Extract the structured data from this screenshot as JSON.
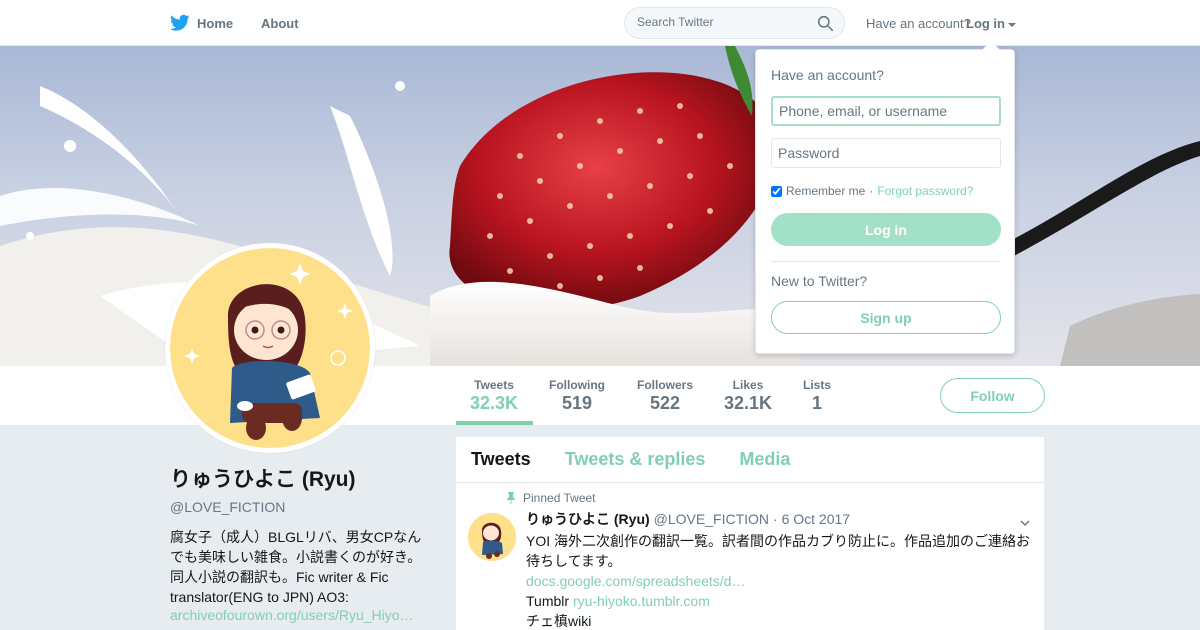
{
  "nav": {
    "home_label": "Home",
    "about_label": "About",
    "search_placeholder": "Search Twitter",
    "have_account_label": "Have an account?",
    "login_label": "Log in",
    "brand_color": "#1da1f2"
  },
  "profile": {
    "name": "りゅうひよこ (Ryu)",
    "handle": "@LOVE_FICTION",
    "bio": "腐女子（成人）BLGLリバ、男女CPなんでも美味しい雑食。小説書くのが好き。同人小説の翻訳も。Fic writer & Fic translator(ENG to JPN) AO3:",
    "bio_link": "archiveofourown.org/users/Ryu_Hiyo…",
    "accent_color": "#80d0b0"
  },
  "stats": [
    {
      "label": "Tweets",
      "value": "32.3K"
    },
    {
      "label": "Following",
      "value": "519"
    },
    {
      "label": "Followers",
      "value": "522"
    },
    {
      "label": "Likes",
      "value": "32.1K"
    },
    {
      "label": "Lists",
      "value": "1"
    }
  ],
  "follow_label": "Follow",
  "timeline": {
    "tabs": [
      "Tweets",
      "Tweets & replies",
      "Media"
    ],
    "pinned_label": "Pinned Tweet",
    "tweet": {
      "name": "りゅうひよこ (Ryu)",
      "handle": "@LOVE_FICTION",
      "date": "· 6 Oct 2017",
      "text": "YOI 海外二次創作の翻訳一覧。訳者間の作品カブり防止に。作品追加のご連絡お待ちしてます。",
      "link": "docs.google.com/spreadsheets/d…",
      "tumblr_prefix": "Tumblr",
      "tumblr_link": "ryu-hiyoko.tumblr.com",
      "extra": "チェ槙wiki"
    }
  },
  "login_dropdown": {
    "title": "Have an account?",
    "username_placeholder": "Phone, email, or username",
    "password_placeholder": "Password",
    "remember_label": "Remember me",
    "separator": "·",
    "forgot_label": "Forgot password?",
    "login_button": "Log in",
    "new_label": "New to Twitter?",
    "signup_button": "Sign up"
  }
}
